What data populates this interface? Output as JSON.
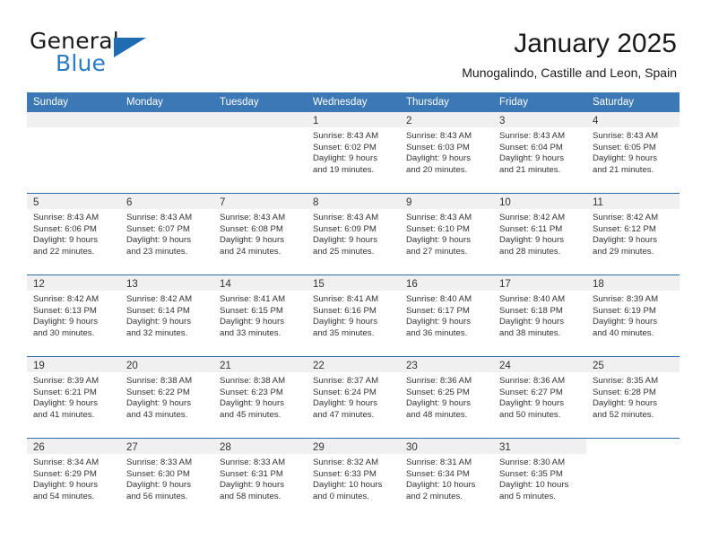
{
  "brand": {
    "word_one": "General",
    "word_two": "Blue",
    "mark": "triangle-mark"
  },
  "header": {
    "month_title": "January 2025",
    "location": "Munogalindo, Castille and Leon, Spain"
  },
  "colors": {
    "header_blue": "#3b78b5",
    "row_divider_blue": "#2a6ba9",
    "day_head_gray": "#f0f0f0",
    "brand_blue": "#2b7cc4",
    "text": "#333333"
  },
  "weekday_headers": [
    "Sunday",
    "Monday",
    "Tuesday",
    "Wednesday",
    "Thursday",
    "Friday",
    "Saturday"
  ],
  "weeks": [
    [
      {
        "day": "",
        "lines": [],
        "state": "blank"
      },
      {
        "day": "",
        "lines": [],
        "state": "blank"
      },
      {
        "day": "",
        "lines": [],
        "state": "blank"
      },
      {
        "day": "1",
        "lines": [
          "Sunrise: 8:43 AM",
          "Sunset: 6:02 PM",
          "Daylight: 9 hours",
          "and 19 minutes."
        ],
        "state": "filled"
      },
      {
        "day": "2",
        "lines": [
          "Sunrise: 8:43 AM",
          "Sunset: 6:03 PM",
          "Daylight: 9 hours",
          "and 20 minutes."
        ],
        "state": "filled"
      },
      {
        "day": "3",
        "lines": [
          "Sunrise: 8:43 AM",
          "Sunset: 6:04 PM",
          "Daylight: 9 hours",
          "and 21 minutes."
        ],
        "state": "filled"
      },
      {
        "day": "4",
        "lines": [
          "Sunrise: 8:43 AM",
          "Sunset: 6:05 PM",
          "Daylight: 9 hours",
          "and 21 minutes."
        ],
        "state": "filled"
      }
    ],
    [
      {
        "day": "5",
        "lines": [
          "Sunrise: 8:43 AM",
          "Sunset: 6:06 PM",
          "Daylight: 9 hours",
          "and 22 minutes."
        ],
        "state": "filled"
      },
      {
        "day": "6",
        "lines": [
          "Sunrise: 8:43 AM",
          "Sunset: 6:07 PM",
          "Daylight: 9 hours",
          "and 23 minutes."
        ],
        "state": "filled"
      },
      {
        "day": "7",
        "lines": [
          "Sunrise: 8:43 AM",
          "Sunset: 6:08 PM",
          "Daylight: 9 hours",
          "and 24 minutes."
        ],
        "state": "filled"
      },
      {
        "day": "8",
        "lines": [
          "Sunrise: 8:43 AM",
          "Sunset: 6:09 PM",
          "Daylight: 9 hours",
          "and 25 minutes."
        ],
        "state": "filled"
      },
      {
        "day": "9",
        "lines": [
          "Sunrise: 8:43 AM",
          "Sunset: 6:10 PM",
          "Daylight: 9 hours",
          "and 27 minutes."
        ],
        "state": "filled"
      },
      {
        "day": "10",
        "lines": [
          "Sunrise: 8:42 AM",
          "Sunset: 6:11 PM",
          "Daylight: 9 hours",
          "and 28 minutes."
        ],
        "state": "filled"
      },
      {
        "day": "11",
        "lines": [
          "Sunrise: 8:42 AM",
          "Sunset: 6:12 PM",
          "Daylight: 9 hours",
          "and 29 minutes."
        ],
        "state": "filled"
      }
    ],
    [
      {
        "day": "12",
        "lines": [
          "Sunrise: 8:42 AM",
          "Sunset: 6:13 PM",
          "Daylight: 9 hours",
          "and 30 minutes."
        ],
        "state": "filled"
      },
      {
        "day": "13",
        "lines": [
          "Sunrise: 8:42 AM",
          "Sunset: 6:14 PM",
          "Daylight: 9 hours",
          "and 32 minutes."
        ],
        "state": "filled"
      },
      {
        "day": "14",
        "lines": [
          "Sunrise: 8:41 AM",
          "Sunset: 6:15 PM",
          "Daylight: 9 hours",
          "and 33 minutes."
        ],
        "state": "filled"
      },
      {
        "day": "15",
        "lines": [
          "Sunrise: 8:41 AM",
          "Sunset: 6:16 PM",
          "Daylight: 9 hours",
          "and 35 minutes."
        ],
        "state": "filled"
      },
      {
        "day": "16",
        "lines": [
          "Sunrise: 8:40 AM",
          "Sunset: 6:17 PM",
          "Daylight: 9 hours",
          "and 36 minutes."
        ],
        "state": "filled"
      },
      {
        "day": "17",
        "lines": [
          "Sunrise: 8:40 AM",
          "Sunset: 6:18 PM",
          "Daylight: 9 hours",
          "and 38 minutes."
        ],
        "state": "filled"
      },
      {
        "day": "18",
        "lines": [
          "Sunrise: 8:39 AM",
          "Sunset: 6:19 PM",
          "Daylight: 9 hours",
          "and 40 minutes."
        ],
        "state": "filled"
      }
    ],
    [
      {
        "day": "19",
        "lines": [
          "Sunrise: 8:39 AM",
          "Sunset: 6:21 PM",
          "Daylight: 9 hours",
          "and 41 minutes."
        ],
        "state": "filled"
      },
      {
        "day": "20",
        "lines": [
          "Sunrise: 8:38 AM",
          "Sunset: 6:22 PM",
          "Daylight: 9 hours",
          "and 43 minutes."
        ],
        "state": "filled"
      },
      {
        "day": "21",
        "lines": [
          "Sunrise: 8:38 AM",
          "Sunset: 6:23 PM",
          "Daylight: 9 hours",
          "and 45 minutes."
        ],
        "state": "filled"
      },
      {
        "day": "22",
        "lines": [
          "Sunrise: 8:37 AM",
          "Sunset: 6:24 PM",
          "Daylight: 9 hours",
          "and 47 minutes."
        ],
        "state": "filled"
      },
      {
        "day": "23",
        "lines": [
          "Sunrise: 8:36 AM",
          "Sunset: 6:25 PM",
          "Daylight: 9 hours",
          "and 48 minutes."
        ],
        "state": "filled"
      },
      {
        "day": "24",
        "lines": [
          "Sunrise: 8:36 AM",
          "Sunset: 6:27 PM",
          "Daylight: 9 hours",
          "and 50 minutes."
        ],
        "state": "filled"
      },
      {
        "day": "25",
        "lines": [
          "Sunrise: 8:35 AM",
          "Sunset: 6:28 PM",
          "Daylight: 9 hours",
          "and 52 minutes."
        ],
        "state": "filled"
      }
    ],
    [
      {
        "day": "26",
        "lines": [
          "Sunrise: 8:34 AM",
          "Sunset: 6:29 PM",
          "Daylight: 9 hours",
          "and 54 minutes."
        ],
        "state": "filled"
      },
      {
        "day": "27",
        "lines": [
          "Sunrise: 8:33 AM",
          "Sunset: 6:30 PM",
          "Daylight: 9 hours",
          "and 56 minutes."
        ],
        "state": "filled"
      },
      {
        "day": "28",
        "lines": [
          "Sunrise: 8:33 AM",
          "Sunset: 6:31 PM",
          "Daylight: 9 hours",
          "and 58 minutes."
        ],
        "state": "filled"
      },
      {
        "day": "29",
        "lines": [
          "Sunrise: 8:32 AM",
          "Sunset: 6:33 PM",
          "Daylight: 10 hours",
          "and 0 minutes."
        ],
        "state": "filled"
      },
      {
        "day": "30",
        "lines": [
          "Sunrise: 8:31 AM",
          "Sunset: 6:34 PM",
          "Daylight: 10 hours",
          "and 2 minutes."
        ],
        "state": "filled"
      },
      {
        "day": "31",
        "lines": [
          "Sunrise: 8:30 AM",
          "Sunset: 6:35 PM",
          "Daylight: 10 hours",
          "and 5 minutes."
        ],
        "state": "filled"
      },
      {
        "day": "",
        "lines": [],
        "state": "empty"
      }
    ]
  ]
}
